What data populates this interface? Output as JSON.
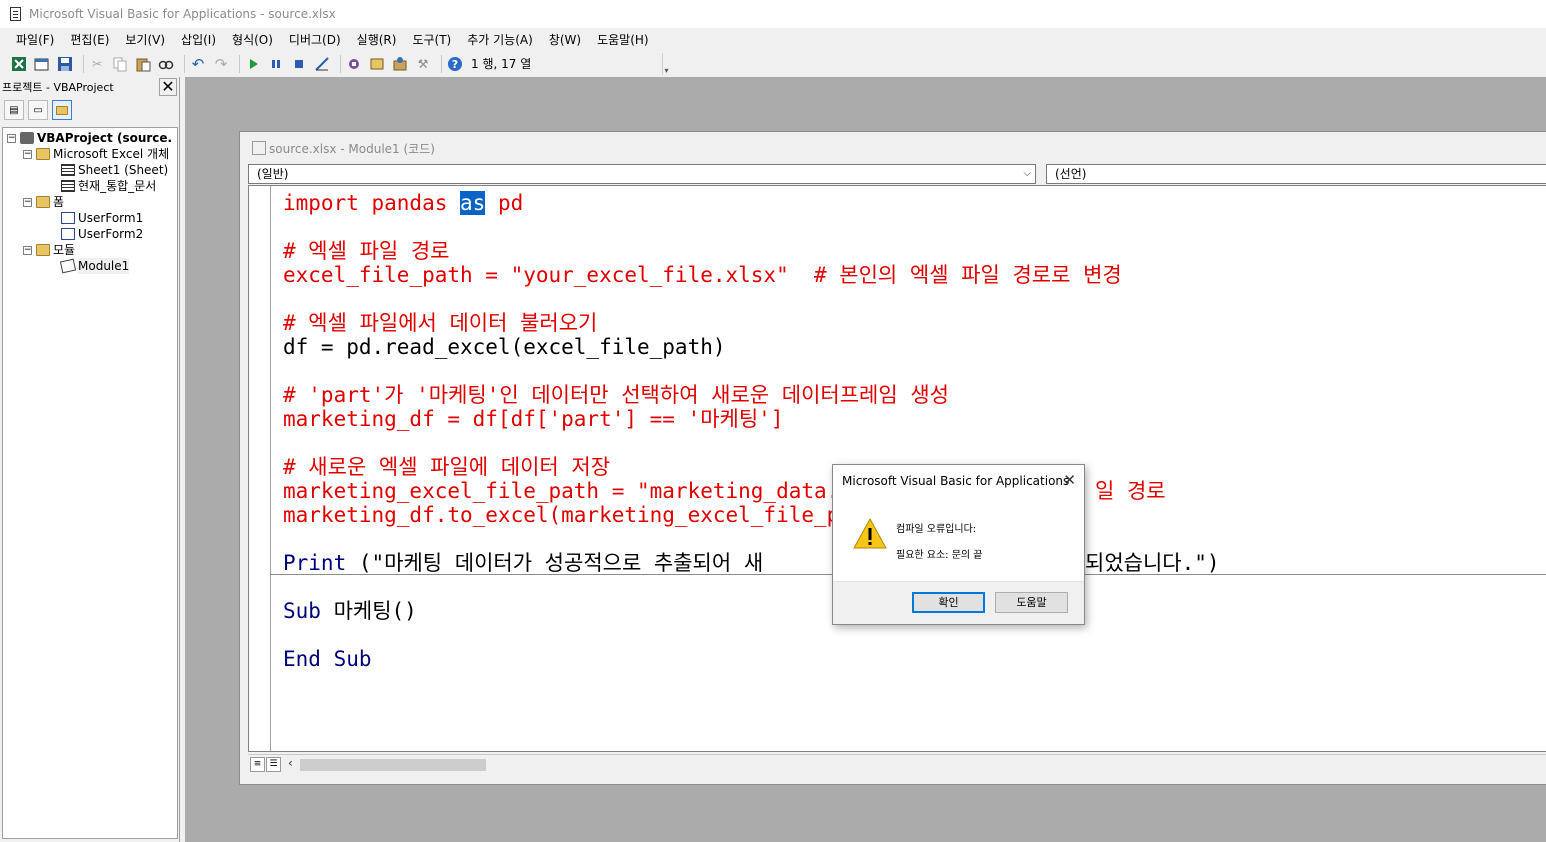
{
  "window": {
    "title": "Microsoft Visual Basic for Applications - source.xlsx"
  },
  "menu": [
    "파일(F)",
    "편집(E)",
    "보기(V)",
    "삽입(I)",
    "형식(O)",
    "디버그(D)",
    "실행(R)",
    "도구(T)",
    "추가 기능(A)",
    "창(W)",
    "도움말(H)"
  ],
  "toolbar": {
    "cursor_position": "1 행, 17 열"
  },
  "project": {
    "title": "프로젝트 - VBAProject",
    "close": "✕",
    "tree": {
      "root": "VBAProject (source.",
      "excel_objects": "Microsoft Excel 개체",
      "sheet1": "Sheet1 (Sheet)",
      "workbook": "현재_통합_문서",
      "forms": "폼",
      "userform1": "UserForm1",
      "userform2": "UserForm2",
      "modules": "모듈",
      "module1": "Module1"
    }
  },
  "code_window": {
    "title": "source.xlsx - Module1 (코드)",
    "object_dropdown": "(일반)",
    "procedure_dropdown": "(선언)",
    "lines": {
      "l1_a": "import pandas ",
      "l1_sel": "as",
      "l1_b": " pd",
      "l2": "# 엑셀 파일 경로",
      "l3": "excel_file_path = \"your_excel_file.xlsx\"  # 본인의 엑셀 파일 경로로 변경",
      "l4": "# 엑셀 파일에서 데이터 불러오기",
      "l5": "df = pd.read_excel(excel_file_path)",
      "l6": "# 'part'가 '마케팅'인 데이터만 선택하여 새로운 데이터프레임 생성",
      "l7": "marketing_df = df[df['part'] == '마케팅']",
      "l8": "# 새로운 엑셀 파일에 데이터 저장",
      "l9": "marketing_excel_file_path = \"marketing_data.xl",
      "l9_end": "일 경로",
      "l10": "marketing_df.to_excel(marketing_excel_file_pat",
      "l11_kw": "Print",
      "l11_a": " (\"마케팅 데이터가 성공적으로 추출되어 새",
      "l11_b": "되었습니다.\")",
      "l12_kw": "Sub",
      "l12_rest": " 마케팅()",
      "l13_kw1": "End",
      "l13_kw2": "Sub"
    }
  },
  "dialog": {
    "title": "Microsoft Visual Basic for Applications",
    "close": "✕",
    "message1": "컴파일 오류입니다:",
    "message2": "필요한 요소: 문의 끝",
    "ok_label": "확인",
    "help_label": "도움말"
  }
}
